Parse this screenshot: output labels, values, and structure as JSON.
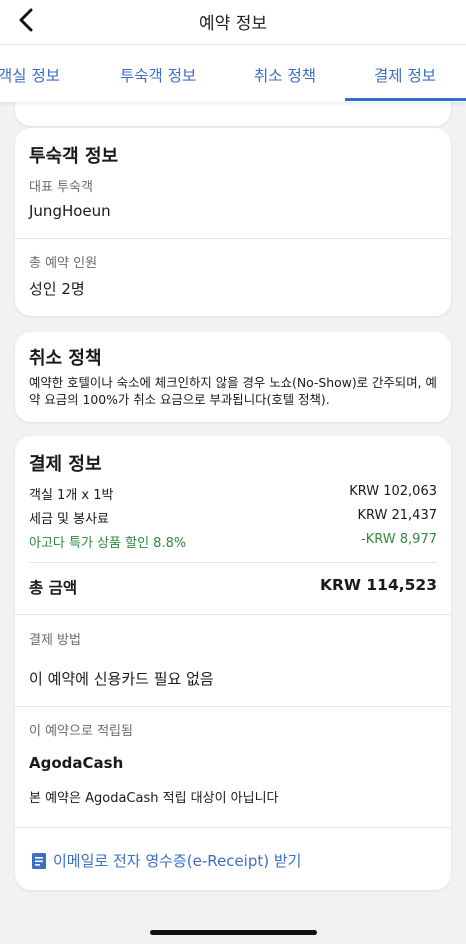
{
  "header": {
    "title": "예약 정보",
    "back_icon": "chevron-left-icon"
  },
  "tabs": [
    {
      "label": "객실 정보"
    },
    {
      "label": "투숙객 정보"
    },
    {
      "label": "취소 정책"
    },
    {
      "label": "결제 정보",
      "active": true
    }
  ],
  "guest": {
    "title": "투숙객 정보",
    "lead_label": "대표 투숙객",
    "lead_value": "JungHoeun",
    "count_label": "총 예약 인원",
    "count_value": "성인 2명"
  },
  "cancel": {
    "title": "취소 정책",
    "text": "예약한 호텔이나 숙소에 체크인하지 않을 경우 노쇼(No-Show)로 간주되며, 예약 요금의 100%가 취소 요금으로 부과됩니다(호텔 정책)."
  },
  "payment": {
    "title": "결제 정보",
    "rows": [
      {
        "label": "객실 1개 x 1박",
        "value": "KRW 102,063"
      },
      {
        "label": "세금 및 봉사료",
        "value": "KRW 21,437"
      },
      {
        "label": "아고다 특가 상품 할인 8.8%",
        "value": "-KRW 8,977"
      }
    ],
    "total_label": "총 금액",
    "total_value": "KRW 114,523",
    "method_label": "결제 방법",
    "method_value": "이 예약에 신용카드 필요 없음",
    "earn_label": "이 예약으로 적립됨",
    "earn_title": "AgodaCash",
    "earn_text": "본 예약은 AgodaCash 적립 대상이 아닙니다",
    "receipt_link": "이메일로 전자 영수증(e-Receipt) 받기",
    "receipt_icon": "receipt-icon"
  },
  "colors": {
    "link": "#3a6fc4",
    "discount": "#2f8a3c",
    "tab_active": "#2f6fd6"
  }
}
